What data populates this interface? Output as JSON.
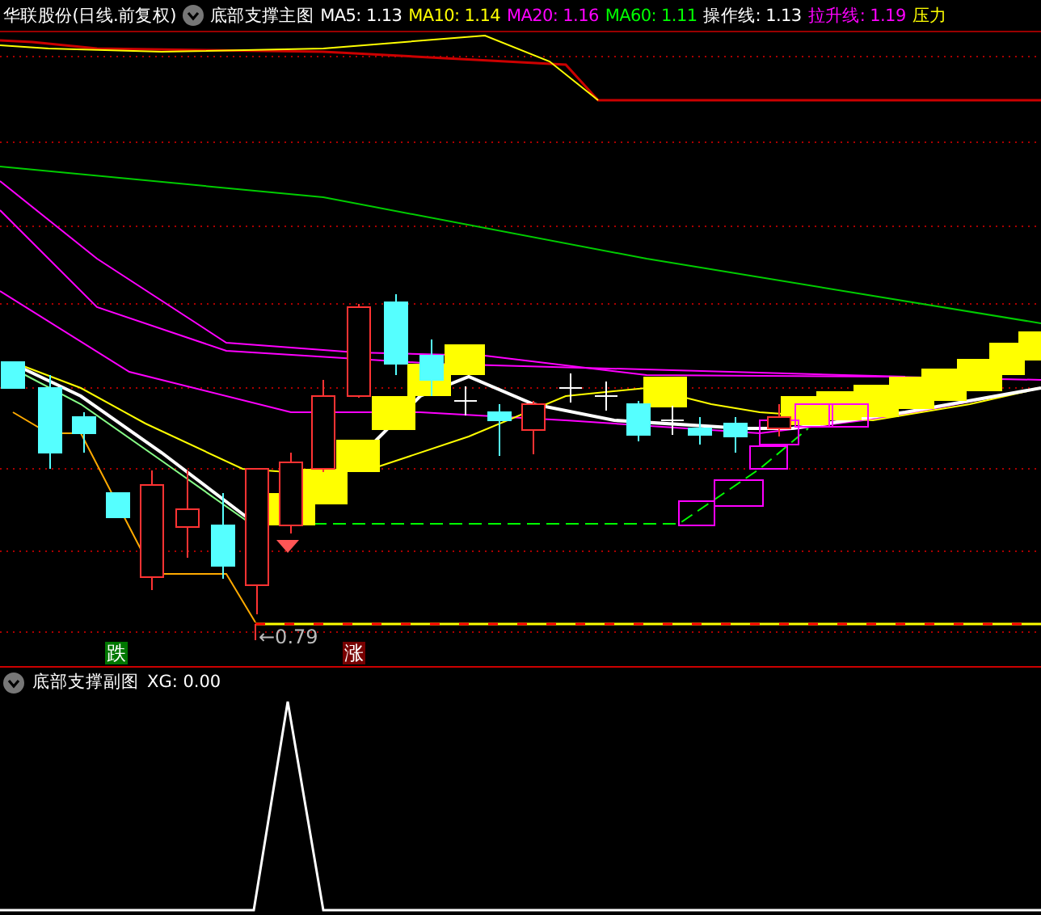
{
  "header": {
    "stock": "华联股份(日线.前复权)",
    "indicator": "底部支撑主图",
    "values": [
      {
        "text": "MA5: 1.13",
        "color": "#ffffff"
      },
      {
        "text": "MA10: 1.14",
        "color": "#ffff00"
      },
      {
        "text": "MA20: 1.16",
        "color": "#ff00ff"
      },
      {
        "text": "MA60: 1.11",
        "color": "#00ff00"
      },
      {
        "text": "操作线: 1.13",
        "color": "#ffffff"
      },
      {
        "text": "拉升线: 1.19",
        "color": "#ff00ff"
      },
      {
        "text": "压力",
        "color": "#ffff00"
      }
    ]
  },
  "main_chart": {
    "low_label": "←0.79",
    "signals": [
      {
        "text": "跌",
        "kind": "down"
      },
      {
        "text": "涨",
        "kind": "up"
      }
    ]
  },
  "sub_chart": {
    "title": "底部支撑副图",
    "value": "XG: 0.00"
  }
}
